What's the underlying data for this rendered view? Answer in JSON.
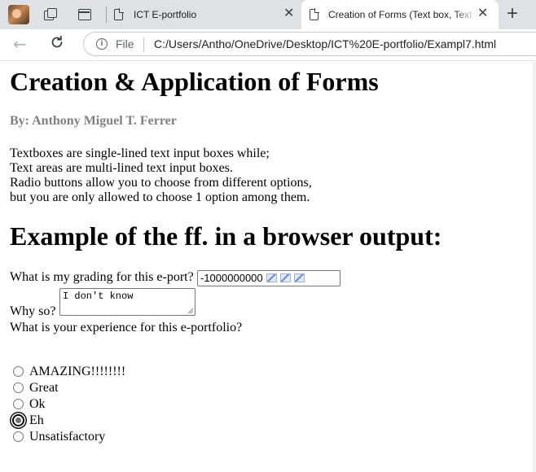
{
  "browser": {
    "tabs": [
      {
        "title": "ICT E-portfolio",
        "active": false
      },
      {
        "title": "Creation of Forms (Text box, Text area, Radio Buttons)",
        "active": true
      }
    ],
    "address": {
      "scheme_label": "File",
      "url": "C:/Users/Antho/OneDrive/Desktop/ICT%20E-portfolio/Exampl7.html"
    },
    "close_glyph": "✕",
    "new_tab_glyph": "+",
    "back_glyph": "←",
    "info_glyph": "i"
  },
  "page": {
    "title": "Creation & Application of Forms",
    "author": "By: Anthony Miguel T. Ferrer",
    "description": [
      "Textboxes are single-lined text input boxes while;",
      "Text areas are multi-lined text input boxes.",
      "Radio buttons allow you to choose from different options,",
      "but you are only allowed to choose 1 option among them."
    ],
    "example_heading": "Example of the ff. in a browser output:",
    "grade_question": "What is my grading for this e-port?",
    "grade_value": "-1000000000",
    "why_question": "Why so?",
    "why_value": "I don't know",
    "experience_question": "What is your experience for this e-portfolio?",
    "options": [
      {
        "label": "AMAZING!!!!!!!!",
        "checked": false
      },
      {
        "label": "Great",
        "checked": false
      },
      {
        "label": "Ok",
        "checked": false
      },
      {
        "label": "Eh",
        "checked": true
      },
      {
        "label": "Unsatisfactory",
        "checked": false
      }
    ]
  }
}
